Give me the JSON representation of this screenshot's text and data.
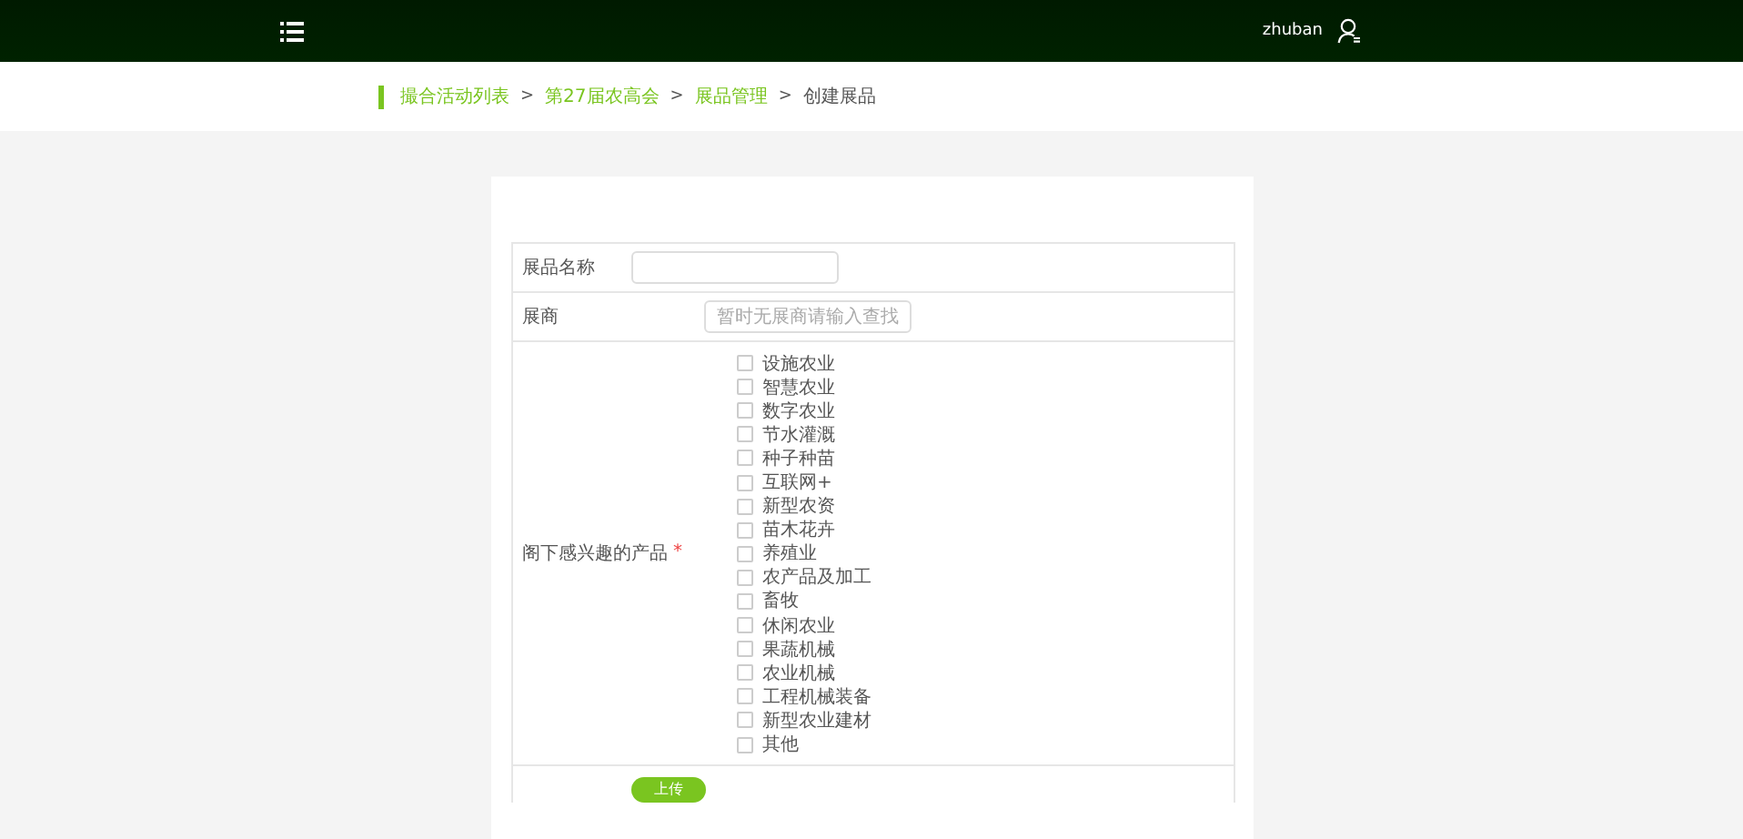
{
  "header": {
    "username": "zhuban"
  },
  "breadcrumb": [
    {
      "label": "撮合活动列表",
      "link": true
    },
    {
      "label": "第27届农高会",
      "link": true
    },
    {
      "label": "展品管理",
      "link": true
    },
    {
      "label": "创建展品",
      "link": false
    }
  ],
  "breadcrumb_separator": ">",
  "form": {
    "name_label": "展品名称",
    "exhibitor_label": "展商",
    "exhibitor_placeholder": "暂时无展商请输入查找",
    "interest_label": "阁下感兴趣的产品",
    "required_mark": "*",
    "options": [
      {
        "label": "设施农业",
        "checked": false
      },
      {
        "label": "智慧农业",
        "checked": false
      },
      {
        "label": "数字农业",
        "checked": false
      },
      {
        "label": "节水灌溉",
        "checked": false
      },
      {
        "label": "种子种苗",
        "checked": false
      },
      {
        "label": "互联网+",
        "checked": false
      },
      {
        "label": "新型农资",
        "checked": false
      },
      {
        "label": "苗木花卉",
        "checked": false
      },
      {
        "label": "养殖业",
        "checked": false
      },
      {
        "label": "农产品及加工",
        "checked": false
      },
      {
        "label": "畜牧",
        "checked": false
      },
      {
        "label": "休闲农业",
        "checked": false
      },
      {
        "label": "果蔬机械",
        "checked": false
      },
      {
        "label": "农业机械",
        "checked": false
      },
      {
        "label": "工程机械装备",
        "checked": false
      },
      {
        "label": "新型农业建材",
        "checked": false
      },
      {
        "label": "其他",
        "checked": false
      }
    ],
    "upload_button": "上传"
  }
}
